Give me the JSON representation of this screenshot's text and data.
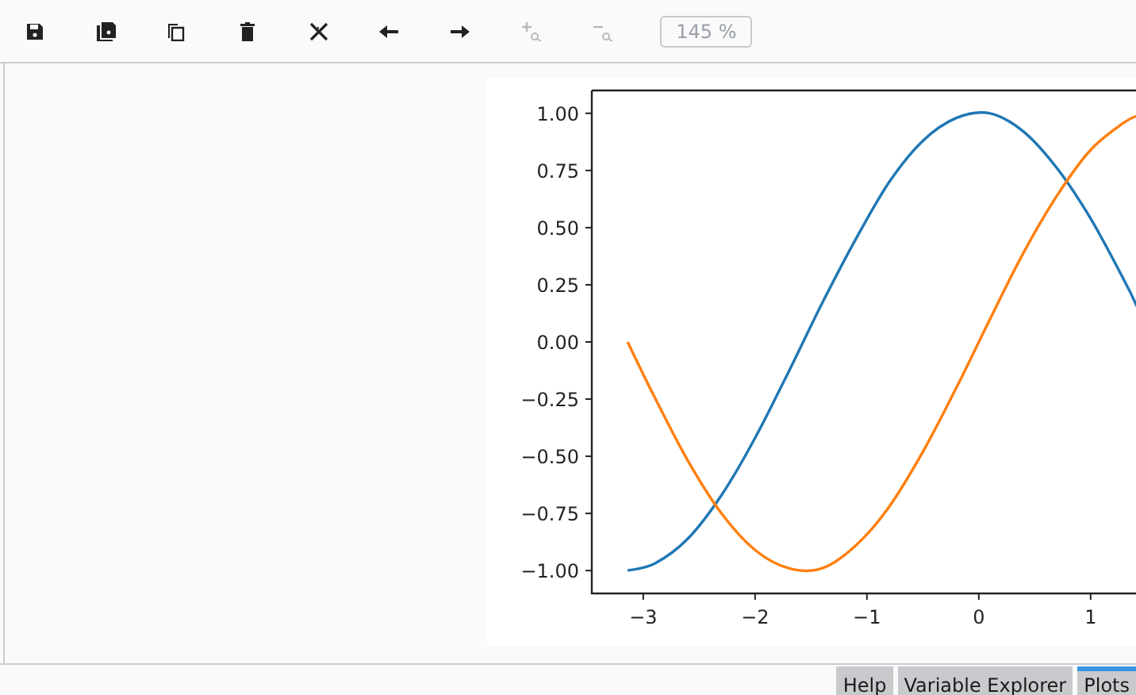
{
  "toolbar": {
    "buttons": [
      {
        "kind": "save",
        "disabled": false
      },
      {
        "kind": "save_all",
        "disabled": false
      },
      {
        "kind": "copy",
        "disabled": false
      },
      {
        "kind": "delete",
        "disabled": false
      },
      {
        "kind": "delete_all",
        "disabled": false
      },
      {
        "kind": "previous",
        "disabled": false
      },
      {
        "kind": "next",
        "disabled": false
      },
      {
        "kind": "zoom_in",
        "disabled": true
      },
      {
        "kind": "zoom_out",
        "disabled": true
      }
    ],
    "zoom_field": {
      "value": "145 %"
    }
  },
  "plot": {
    "chart_data": {
      "type": "line",
      "xlim": [
        -3.46,
        1.42
      ],
      "ylim": [
        -1.1,
        1.1
      ],
      "x": [
        -3.14,
        -2.9,
        -2.6,
        -2.3,
        -2.0,
        -1.7,
        -1.4,
        -1.1,
        -0.8,
        -0.5,
        -0.2,
        0.1,
        0.4,
        0.7,
        1.0,
        1.3,
        1.42
      ],
      "series": [
        {
          "color": "#1f77b4",
          "values": [
            -1.0,
            -0.97,
            -0.86,
            -0.67,
            -0.42,
            -0.13,
            0.17,
            0.45,
            0.7,
            0.88,
            0.98,
            1.0,
            0.92,
            0.76,
            0.54,
            0.27,
            0.15
          ]
        },
        {
          "color": "#ff7f0e",
          "values": [
            0.0,
            -0.24,
            -0.52,
            -0.75,
            -0.91,
            -0.99,
            -0.99,
            -0.89,
            -0.72,
            -0.48,
            -0.2,
            0.1,
            0.39,
            0.64,
            0.84,
            0.96,
            0.99
          ]
        }
      ],
      "xticks": [
        {
          "value": -3,
          "label": "−3"
        },
        {
          "value": -2,
          "label": "−2"
        },
        {
          "value": -1,
          "label": "−1"
        },
        {
          "value": 0,
          "label": "0"
        },
        {
          "value": 1,
          "label": "1"
        }
      ],
      "yticks": [
        {
          "value": 1,
          "label": "1.00"
        },
        {
          "value": 0.75,
          "label": "0.75"
        },
        {
          "value": 0.5,
          "label": "0.50"
        },
        {
          "value": 0.25,
          "label": "0.25"
        },
        {
          "value": 0,
          "label": "0.00"
        },
        {
          "value": -0.25,
          "label": "−0.25"
        },
        {
          "value": -0.5,
          "label": "−0.50"
        },
        {
          "value": -0.75,
          "label": "−0.75"
        },
        {
          "value": -1,
          "label": "−1.00"
        }
      ]
    }
  },
  "tabs": [
    {
      "label": "Help",
      "selected": false
    },
    {
      "label": "Variable Explorer",
      "selected": false
    },
    {
      "label": "Plots",
      "selected": true
    }
  ]
}
